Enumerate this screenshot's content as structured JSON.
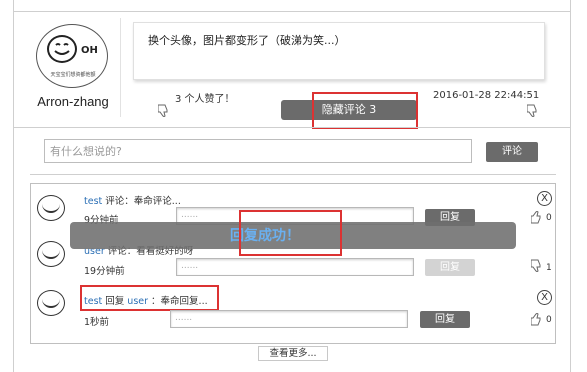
{
  "post": {
    "username": "Arron-zhang",
    "avatar_mark": "OH",
    "avatar_caption": "天宝宝们想资都他额",
    "content": "换个头像，图片都变形了（破涕为笑...）",
    "likes_text": "3 个人赞了！",
    "date": "2016-01-28 22:44:51",
    "hide_comments_label": "隐藏评论 3"
  },
  "comment_form": {
    "placeholder": "有什么想说的?",
    "submit_label": "评论"
  },
  "comments": [
    {
      "user": "test",
      "action": " 评论：",
      "reply_to": "",
      "text": "奉命评论...",
      "time": "9分钟前",
      "reply_placeholder": "......",
      "reply_label": "回复",
      "likes": "0",
      "close": "X"
    },
    {
      "user": "user",
      "action": " 评论：",
      "reply_to": "",
      "text": "看看挺好的呀",
      "time": "19分钟前",
      "reply_placeholder": "......",
      "reply_label": "回复",
      "likes": "1",
      "close": ""
    },
    {
      "user": "test",
      "action": " 回复 ",
      "reply_to": "user",
      "text": " ：奉命回复...",
      "time": "1秒前",
      "reply_placeholder": "......",
      "reply_label": "回复",
      "likes": "0",
      "close": "X"
    }
  ],
  "toast": {
    "message": "回复成功！"
  },
  "load_more_label": "查看更多...",
  "icons": {
    "like": "thumbs-up-icon",
    "unlike": "thumbs-down-icon",
    "close": "close-icon"
  },
  "colors": {
    "dark_button": "#6b6b6b",
    "light_button": "#d3d3d3",
    "link": "#2b6fb5",
    "highlight": "#dc3232",
    "toast_text": "#6ab0f0"
  }
}
